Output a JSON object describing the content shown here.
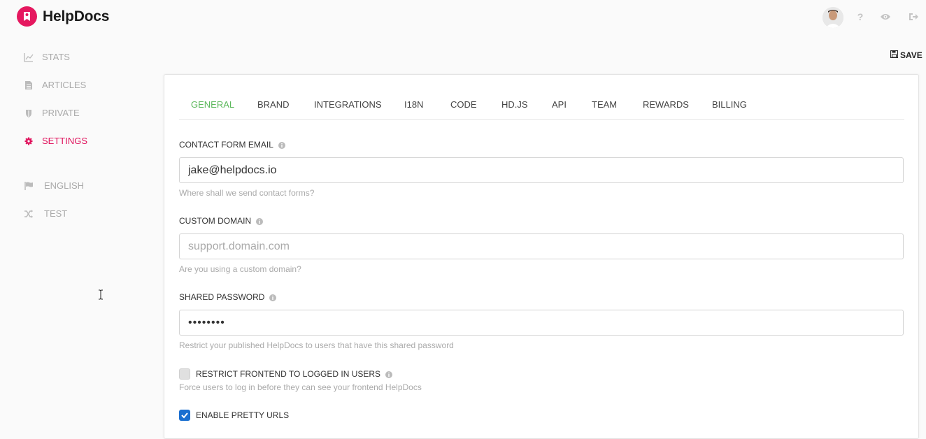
{
  "app": {
    "name": "HelpDocs"
  },
  "header": {
    "icons": [
      "avatar",
      "question-icon",
      "eye-icon",
      "sign-out-icon"
    ],
    "help_glyph": "?",
    "save_label": "SAVE"
  },
  "sidebar": {
    "items": [
      {
        "label": "STATS",
        "icon": "chart-line-icon"
      },
      {
        "label": "ARTICLES",
        "icon": "document-icon"
      },
      {
        "label": "PRIVATE",
        "icon": "shield-icon"
      },
      {
        "label": "SETTINGS",
        "icon": "gear-icon",
        "active": true
      },
      {
        "label": "ENGLISH",
        "icon": "flag-icon"
      },
      {
        "label": "TEST",
        "icon": "shuffle-icon"
      }
    ]
  },
  "tabs": [
    {
      "label": "GENERAL",
      "active": true
    },
    {
      "label": "BRAND"
    },
    {
      "label": "INTEGRATIONS"
    },
    {
      "label": "I18N"
    },
    {
      "label": "CODE"
    },
    {
      "label": "HD.JS"
    },
    {
      "label": "API"
    },
    {
      "label": "TEAM"
    },
    {
      "label": "REWARDS"
    },
    {
      "label": "BILLING"
    }
  ],
  "form": {
    "contact_email": {
      "label": "CONTACT FORM EMAIL",
      "value": "jake@helpdocs.io",
      "help": "Where shall we send contact forms?"
    },
    "custom_domain": {
      "label": "CUSTOM DOMAIN",
      "value": "",
      "placeholder": "support.domain.com",
      "help": "Are you using a custom domain?"
    },
    "shared_password": {
      "label": "SHARED PASSWORD",
      "value": "••••••••",
      "help": "Restrict your published HelpDocs to users that have this shared password"
    },
    "restrict_frontend": {
      "label": "RESTRICT FRONTEND TO LOGGED IN USERS",
      "checked": false,
      "help": "Force users to log in before they can see your frontend HelpDocs"
    },
    "pretty_urls": {
      "label": "ENABLE PRETTY URLS",
      "checked": true
    }
  },
  "colors": {
    "brand": "#e5185f",
    "active_nav": "#e0125c",
    "active_tab": "#5cb85c",
    "checkbox_on": "#1a6fd0"
  }
}
